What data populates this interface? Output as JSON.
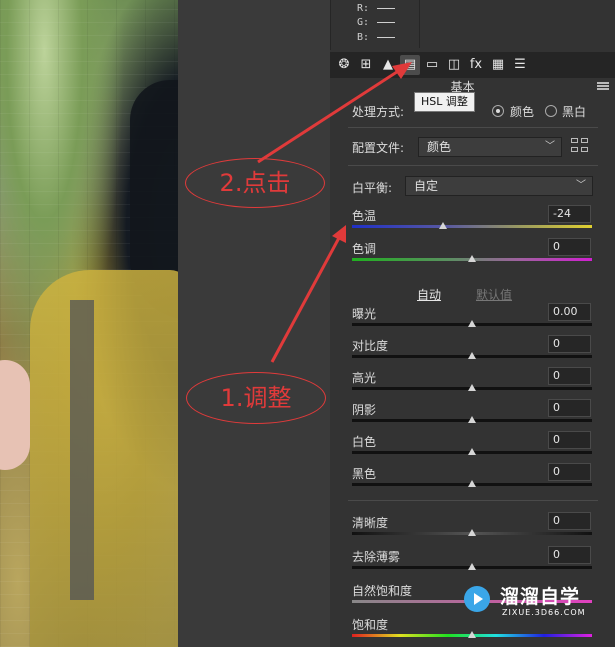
{
  "rgb_readout": {
    "r_label": "R:",
    "g_label": "G:",
    "b_label": "B:"
  },
  "toolbar": {
    "tools": [
      {
        "name": "basic-tool-icon",
        "glyph": "❂"
      },
      {
        "name": "tone-curve-tool-icon",
        "glyph": "⊞"
      },
      {
        "name": "detail-tool-icon",
        "glyph": "▲"
      },
      {
        "name": "hsl-tool-icon",
        "glyph": "▤"
      },
      {
        "name": "split-toning-tool-icon",
        "glyph": "▭"
      },
      {
        "name": "lens-corrections-tool-icon",
        "glyph": "◫"
      },
      {
        "name": "effects-tool-icon",
        "glyph": "fx"
      },
      {
        "name": "calibration-tool-icon",
        "glyph": "▦"
      },
      {
        "name": "presets-tool-icon",
        "glyph": "☰"
      }
    ],
    "active_tool": "hsl-tool-icon"
  },
  "panel": {
    "section_title": "基本",
    "tooltip": "HSL 调整",
    "treatment_label": "处理方式:",
    "treatment_options": [
      "颜色",
      "黑白"
    ],
    "treatment_selected": "颜色",
    "profile_label": "配置文件:",
    "profile_value": "颜色",
    "wb_label": "白平衡:",
    "wb_value": "自定",
    "auto_label": "自动",
    "default_label": "默认值"
  },
  "sliders": [
    {
      "key": "temp",
      "label": "色温",
      "value": "-24",
      "level": 0.38
    },
    {
      "key": "tint",
      "label": "色调",
      "value": "0",
      "level": 0.5
    },
    {
      "key": "exposure",
      "label": "曝光",
      "value": "0.00",
      "level": 0.5
    },
    {
      "key": "contrast",
      "label": "对比度",
      "value": "0",
      "level": 0.5
    },
    {
      "key": "highlights",
      "label": "高光",
      "value": "0",
      "level": 0.5
    },
    {
      "key": "shadows",
      "label": "阴影",
      "value": "0",
      "level": 0.5
    },
    {
      "key": "whites",
      "label": "白色",
      "value": "0",
      "level": 0.5
    },
    {
      "key": "blacks",
      "label": "黑色",
      "value": "0",
      "level": 0.5
    },
    {
      "key": "clarity",
      "label": "清晰度",
      "value": "0",
      "level": 0.5
    },
    {
      "key": "dehaze",
      "label": "去除薄雾",
      "value": "0",
      "level": 0.5
    },
    {
      "key": "vibrance",
      "label": "自然饱和度",
      "value": "",
      "level": 0.5
    },
    {
      "key": "saturation",
      "label": "饱和度",
      "value": "",
      "level": 0.5
    }
  ],
  "annotations": {
    "step1": "1.调整",
    "step2": "2.点击",
    "color": "#e03a3a"
  },
  "watermark": {
    "title": "溜溜自学",
    "url": "ZIXUE.3D66.COM"
  }
}
